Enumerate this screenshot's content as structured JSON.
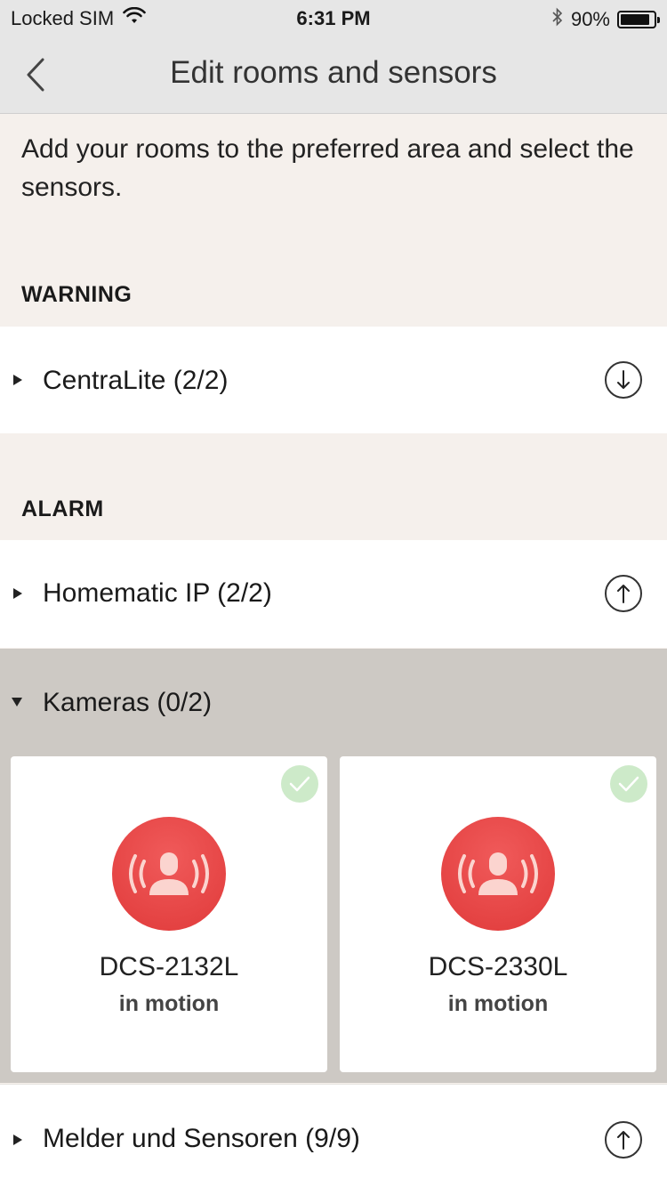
{
  "status": {
    "carrier": "Locked SIM",
    "time": "6:31 PM",
    "battery_text": "90%",
    "battery_level": 0.9
  },
  "nav": {
    "title": "Edit rooms and sensors"
  },
  "intro": "Add your rooms to the preferred area and select the sensors.",
  "sections": {
    "warning": {
      "title": "WARNING",
      "rows": [
        {
          "label": "CentraLite (2/2)",
          "action": "down-arrow-icon"
        }
      ]
    },
    "alarm": {
      "title": "ALARM",
      "rows": [
        {
          "label": "Homematic IP (2/2)",
          "action": "up-arrow-icon"
        },
        {
          "label": "Kameras (0/2)",
          "expanded": true
        },
        {
          "label": "Melder und Sensoren (9/9)",
          "action": "up-arrow-icon"
        }
      ]
    }
  },
  "cards": [
    {
      "name": "DCS-2132L",
      "state": "in motion",
      "selected": true,
      "icon": "motion-sensor-icon"
    },
    {
      "name": "DCS-2330L",
      "state": "in motion",
      "selected": true,
      "icon": "motion-sensor-icon"
    }
  ],
  "colors": {
    "accent_red": "#e84848",
    "check_green": "#cdeac9",
    "expanded_bg": "#cdc9c4",
    "page_bg": "#f5f0ec"
  }
}
